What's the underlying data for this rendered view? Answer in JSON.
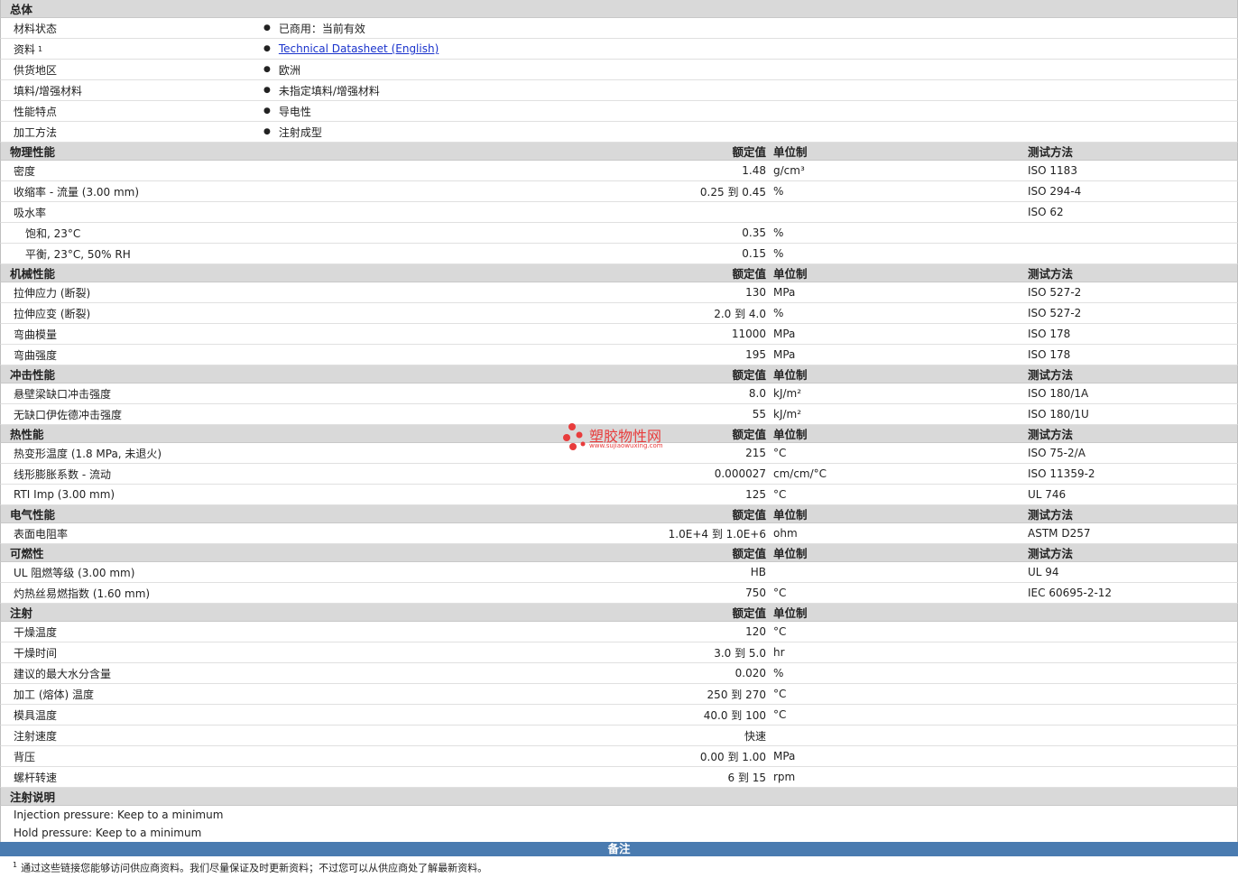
{
  "general": {
    "title": "总体",
    "rows": [
      {
        "label": "材料状态",
        "value": "已商用：当前有效"
      },
      {
        "label": "资料",
        "sup": "1",
        "value": "Technical Datasheet (English)",
        "link": true
      },
      {
        "label": "供货地区",
        "value": "欧洲"
      },
      {
        "label": "填料/增强材料",
        "value": "未指定填料/增强材料"
      },
      {
        "label": "性能特点",
        "value": "导电性"
      },
      {
        "label": "加工方法",
        "value": "注射成型"
      }
    ]
  },
  "header_labels": {
    "value": "额定值",
    "unit": "单位制",
    "method": "测试方法"
  },
  "sections": [
    {
      "title": "物理性能",
      "rows": [
        {
          "label": "密度",
          "value": "1.48",
          "unit": "g/cm³",
          "method": "ISO 1183"
        },
        {
          "label": "收缩率 - 流量 (3.00 mm)",
          "value": "0.25 到 0.45",
          "unit": "%",
          "method": "ISO 294-4"
        },
        {
          "label": "吸水率",
          "value": "",
          "unit": "",
          "method": "ISO 62"
        },
        {
          "label": "饱和, 23°C",
          "value": "0.35",
          "unit": "%",
          "method": "",
          "sub": true
        },
        {
          "label": "平衡, 23°C, 50% RH",
          "value": "0.15",
          "unit": "%",
          "method": "",
          "sub": true
        }
      ]
    },
    {
      "title": "机械性能",
      "rows": [
        {
          "label": "拉伸应力 (断裂)",
          "value": "130",
          "unit": "MPa",
          "method": "ISO 527-2"
        },
        {
          "label": "拉伸应变 (断裂)",
          "value": "2.0 到 4.0",
          "unit": "%",
          "method": "ISO 527-2"
        },
        {
          "label": "弯曲模量",
          "value": "11000",
          "unit": "MPa",
          "method": "ISO 178"
        },
        {
          "label": "弯曲强度",
          "value": "195",
          "unit": "MPa",
          "method": "ISO 178"
        }
      ]
    },
    {
      "title": "冲击性能",
      "rows": [
        {
          "label": "悬壁梁缺口冲击强度",
          "value": "8.0",
          "unit": "kJ/m²",
          "method": "ISO 180/1A"
        },
        {
          "label": "无缺口伊佐德冲击强度",
          "value": "55",
          "unit": "kJ/m²",
          "method": "ISO 180/1U"
        }
      ]
    },
    {
      "title": "热性能",
      "rows": [
        {
          "label": "热变形温度 (1.8 MPa, 未退火)",
          "value": "215",
          "unit": "°C",
          "method": "ISO 75-2/A"
        },
        {
          "label": "线形膨胀系数 - 流动",
          "value": "0.000027",
          "unit": "cm/cm/°C",
          "method": "ISO 11359-2"
        },
        {
          "label": "RTI Imp (3.00 mm)",
          "value": "125",
          "unit": "°C",
          "method": "UL 746"
        }
      ]
    },
    {
      "title": "电气性能",
      "rows": [
        {
          "label": "表面电阻率",
          "value": "1.0E+4 到 1.0E+6",
          "unit": "ohm",
          "method": "ASTM D257"
        }
      ]
    },
    {
      "title": "可燃性",
      "rows": [
        {
          "label": "UL 阻燃等级 (3.00 mm)",
          "value": "HB",
          "unit": "",
          "method": "UL 94"
        },
        {
          "label": "灼热丝易燃指数 (1.60 mm)",
          "value": "750",
          "unit": "°C",
          "method": "IEC 60695-2-12"
        }
      ]
    },
    {
      "title": "注射",
      "rows": [
        {
          "label": "干燥温度",
          "value": "120",
          "unit": "°C",
          "method": ""
        },
        {
          "label": "干燥时间",
          "value": "3.0 到 5.0",
          "unit": "hr",
          "method": ""
        },
        {
          "label": "建议的最大水分含量",
          "value": "0.020",
          "unit": "%",
          "method": ""
        },
        {
          "label": "加工 (熔体) 温度",
          "value": "250 到 270",
          "unit": "°C",
          "method": ""
        },
        {
          "label": "模具温度",
          "value": "40.0 到 100",
          "unit": "°C",
          "method": ""
        },
        {
          "label": "注射速度",
          "value": "快速",
          "unit": "",
          "method": ""
        },
        {
          "label": "背压",
          "value": "0.00 到 1.00",
          "unit": "MPa",
          "method": ""
        },
        {
          "label": "螺杆转速",
          "value": "6 到 15",
          "unit": "rpm",
          "method": ""
        }
      ]
    }
  ],
  "notes": {
    "title": "注射说明",
    "lines": [
      "Injection pressure: Keep to a minimum",
      "Hold pressure: Keep to a minimum"
    ]
  },
  "remarks": {
    "title": "备注",
    "footnote_num": "1",
    "footnote": "通过这些链接您能够访问供应商资料。我们尽量保证及时更新资料；不过您可以从供应商处了解最新资料。"
  },
  "watermark": {
    "title": "塑胶物性网",
    "url": "www.sujiaowuxing.com"
  }
}
